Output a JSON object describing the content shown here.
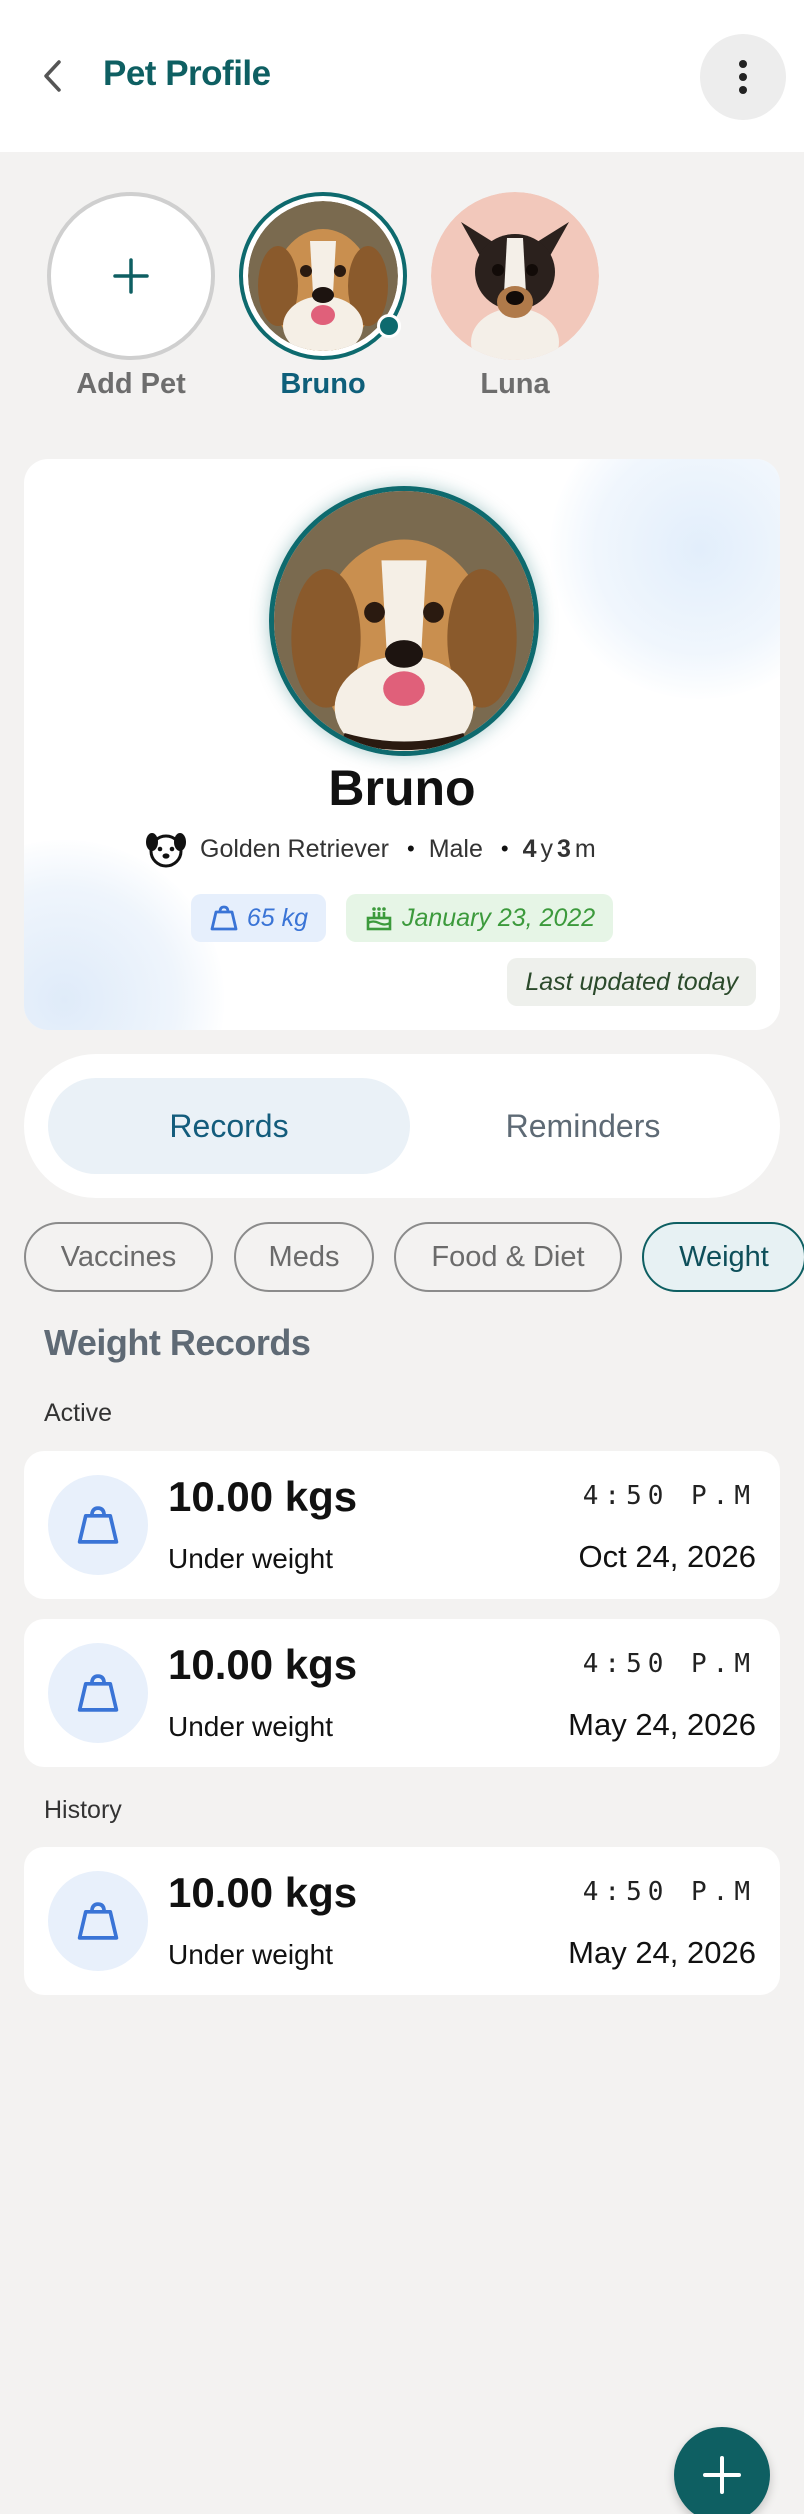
{
  "header": {
    "title": "Pet Profile",
    "back_icon": "chevron-left-icon",
    "menu_icon": "more-vertical-icon"
  },
  "pets": {
    "add_label": "Add Pet",
    "items": [
      {
        "name": "Bruno",
        "selected": true
      },
      {
        "name": "Luna",
        "selected": false
      }
    ]
  },
  "profile": {
    "name": "Bruno",
    "breed": "Golden Retriever",
    "gender": "Male",
    "age_years": "4",
    "age_years_unit": "y",
    "age_months": "3",
    "age_months_unit": "m",
    "weight": "65 kg",
    "birthday": "January 23, 2022",
    "last_updated": "Last updated today"
  },
  "tabs": [
    {
      "label": "Records",
      "active": true
    },
    {
      "label": "Reminders",
      "active": false
    }
  ],
  "filters": [
    {
      "label": "Vaccines",
      "active": false
    },
    {
      "label": "Meds",
      "active": false
    },
    {
      "label": "Food & Diet",
      "active": false
    },
    {
      "label": "Weight",
      "active": true
    }
  ],
  "records_section": {
    "title": "Weight Records",
    "active_label": "Active",
    "history_label": "History",
    "active": [
      {
        "weight": "10.00 kgs",
        "status": "Under weight",
        "time": "4:50 P.M",
        "date": "Oct 24, 2026"
      },
      {
        "weight": "10.00 kgs",
        "status": "Under weight",
        "time": "4:50 P.M",
        "date": "May 24, 2026"
      }
    ],
    "history": [
      {
        "weight": "10.00 kgs",
        "status": "Under weight",
        "time": "4:50 P.M",
        "date": "May 24, 2026"
      }
    ]
  },
  "colors": {
    "brand": "#0e5f62",
    "accent_blue": "#3a74d6",
    "accent_green": "#3c9a3c",
    "background": "#f3f2f1"
  }
}
